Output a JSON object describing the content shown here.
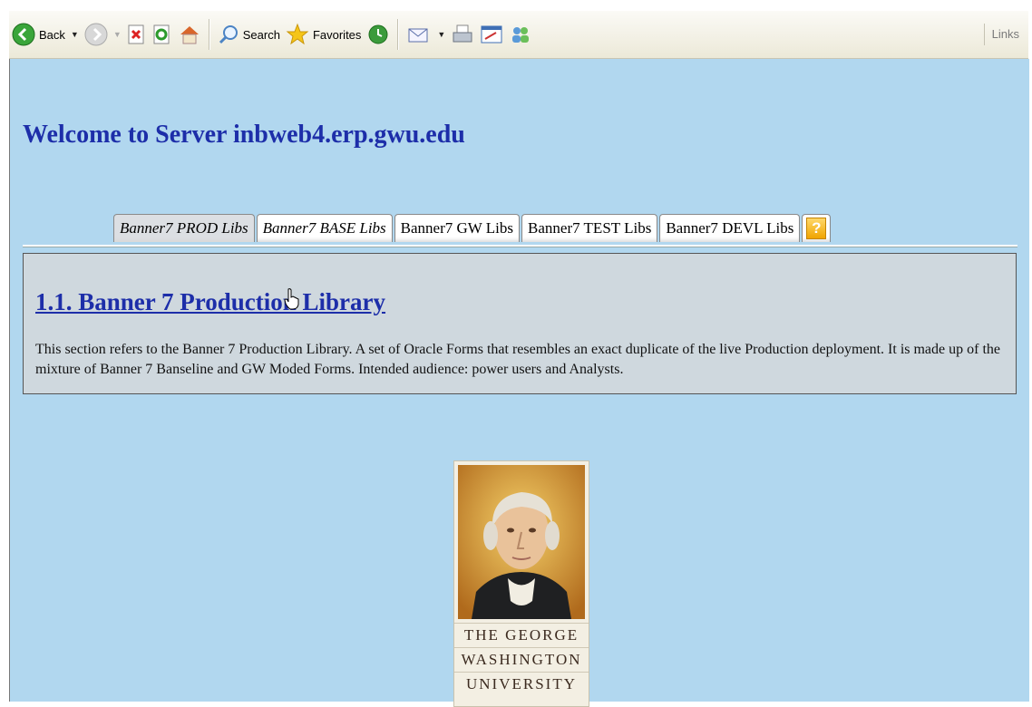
{
  "toolbar": {
    "back_label": "Back",
    "search_label": "Search",
    "favorites_label": "Favorites",
    "links_label": "Links"
  },
  "page": {
    "welcome": "Welcome to Server inbweb4.erp.gwu.edu",
    "tabs": [
      {
        "label": "Banner7 PROD Libs"
      },
      {
        "label": "Banner7 BASE Libs"
      },
      {
        "label": "Banner7 GW Libs"
      },
      {
        "label": "Banner7 TEST Libs"
      },
      {
        "label": "Banner7 DEVL Libs"
      }
    ],
    "help_glyph": "?",
    "section_title": "1.1. Banner 7 Production Library",
    "section_text": "This section refers to the Banner 7 Production Library. A set of Oracle Forms that resembles an exact duplicate of the live Production deployment. It is made up of the mixture of Banner 7 Banseline and GW Moded Forms. Intended audience: power users and Analysts.",
    "logo_lines": [
      "THE GEORGE",
      "WASHINGTON",
      "UNIVERSITY"
    ]
  },
  "colors": {
    "page_background": "#b1d7ef",
    "heading": "#1d2ea9",
    "panel_background": "#cfd8de"
  }
}
